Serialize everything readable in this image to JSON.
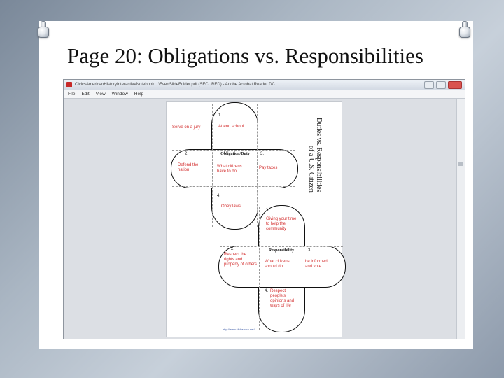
{
  "slide": {
    "title": "Page 20: Obligations vs. Responsibilities"
  },
  "window": {
    "title": "CivicsAmericanHistoryInteractiveNotebook…\\EvenSlideFolder.pdf (SECURED) - Adobe Acrobat Reader DC",
    "menu": [
      "File",
      "Edit",
      "View",
      "Window",
      "Help"
    ]
  },
  "document": {
    "vertical_title_line1": "Duties vs. Responsibilities",
    "vertical_title_line2": "of a U.S. Citizen",
    "obligation": {
      "center": "Obligation/Duty",
      "n1": "1.",
      "n2": "2.",
      "n3": "3.",
      "n4": "4.",
      "item1": "Attend school",
      "item2": "Defend the nation",
      "item3": "Pay taxes",
      "item4": "Obey laws",
      "center_note": "What citizens have to do",
      "outside_left": "Serve on a jury"
    },
    "responsibility": {
      "center": "Responsibility",
      "n1": "1.",
      "n2": "2.",
      "n3": "3.",
      "n4": "4.",
      "item1": "Giving your time to help the community",
      "item2": "Respect the rights and property of others",
      "item3": "be informed and vote",
      "item4": "Respect people's opinions and ways of life",
      "center_note": "What citizens should do"
    },
    "footer_url": "http://www.slideshare.net/..."
  }
}
